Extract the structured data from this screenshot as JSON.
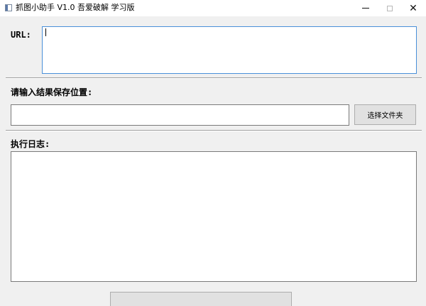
{
  "window": {
    "title": "抓图小助手 V1.0 吾爱破解 学习版",
    "minimize_glyph": "",
    "close_glyph": "✕"
  },
  "url_section": {
    "label": "URL:",
    "value": "",
    "placeholder": ""
  },
  "save_section": {
    "label": "请输入结果保存位置:",
    "value": "",
    "placeholder": "",
    "choose_button_label": "选择文件夹"
  },
  "log_section": {
    "label": "执行日志:",
    "value": ""
  },
  "bottom_button": {
    "label": ""
  },
  "icons": {
    "app": "app-window-icon",
    "minimize": "minimize-icon",
    "maximize": "maximize-icon",
    "close": "close-icon"
  },
  "colors": {
    "background": "#f0f0f0",
    "focus_border": "#4a90d9",
    "button_face": "#e1e1e1"
  }
}
